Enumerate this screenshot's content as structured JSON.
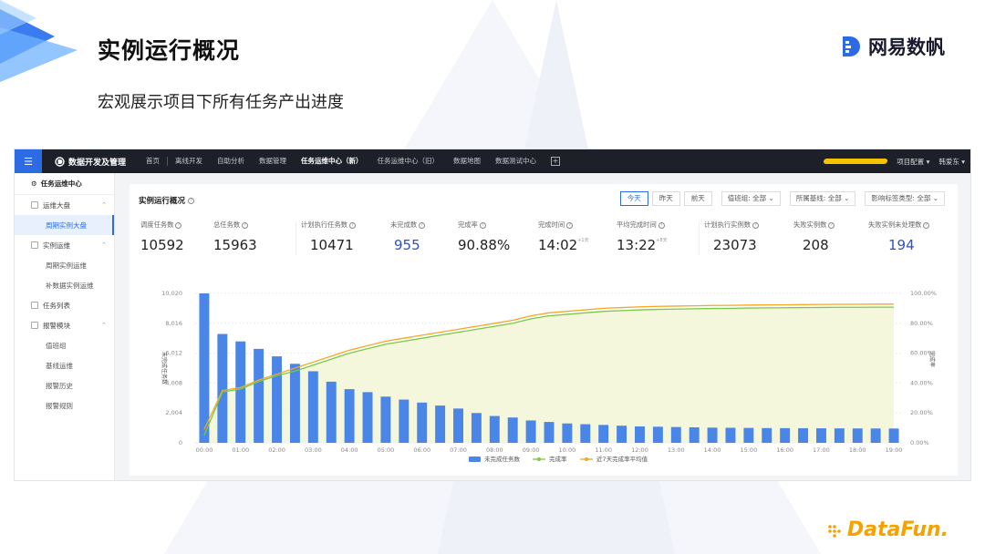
{
  "slide": {
    "title": "实例运行概况",
    "subtitle": "宏观展示项目下所有任务产出进度",
    "brand": "网易数帆",
    "footer_brand": "DataFun."
  },
  "app": {
    "title": "数据开发及管理",
    "nav": [
      {
        "label": "首页",
        "active": false
      },
      {
        "label": "离线开发",
        "active": false
      },
      {
        "label": "自助分析",
        "active": false
      },
      {
        "label": "数据管理",
        "active": false
      },
      {
        "label": "任务运维中心（新）",
        "active": true
      },
      {
        "label": "任务运维中心（旧）",
        "active": false
      },
      {
        "label": "数据地图",
        "active": false
      },
      {
        "label": "数据测试中心",
        "active": false
      }
    ],
    "plus": "+",
    "project_config": "项目配置 ▾",
    "user": "韩爱东 ▾"
  },
  "sidebar": {
    "header": "任务运维中心",
    "groups": [
      {
        "label": "运维大盘",
        "items": [
          {
            "label": "周期实例大盘",
            "active": true
          }
        ]
      },
      {
        "label": "实例运维",
        "items": [
          {
            "label": "周期实例运维",
            "active": false
          },
          {
            "label": "补数据实例运维",
            "active": false
          }
        ]
      },
      {
        "label": "任务列表",
        "items": []
      },
      {
        "label": "报警模块",
        "items": [
          {
            "label": "值班组",
            "active": false
          },
          {
            "label": "基线运维",
            "active": false
          },
          {
            "label": "报警历史",
            "active": false
          },
          {
            "label": "报警规则",
            "active": false
          }
        ]
      }
    ]
  },
  "panel": {
    "title": "实例运行概况",
    "days": [
      {
        "label": "今天",
        "active": true
      },
      {
        "label": "昨天",
        "active": false
      },
      {
        "label": "前天",
        "active": false
      }
    ],
    "selects": [
      "值班组: 全部 ⌄",
      "所属基线: 全部 ⌄",
      "影响标签类型: 全部 ⌄"
    ]
  },
  "stats": [
    {
      "label": "调度任务数",
      "value": "10592",
      "color": "#222222"
    },
    {
      "label": "总任务数",
      "value": "15963",
      "color": "#222222"
    },
    {
      "label": "计划执行任务数",
      "value": "10471",
      "color": "#222222"
    },
    {
      "label": "未完成数",
      "value": "955",
      "color": "#2d4fc7"
    },
    {
      "label": "完成率",
      "value": "90.88%",
      "color": "#222222"
    },
    {
      "label": "完成时间",
      "value": "14:02",
      "sup": "+1天",
      "color": "#222222"
    },
    {
      "label": "平均完成时间",
      "value": "13:22",
      "sup": "+8天",
      "color": "#222222"
    },
    {
      "label": "计划执行实例数",
      "value": "23073",
      "color": "#222222"
    },
    {
      "label": "失败实例数",
      "value": "208",
      "color": "#222222"
    },
    {
      "label": "失败实例未处理数",
      "value": "194",
      "color": "#2d4fc7"
    }
  ],
  "chart_data": {
    "type": "bar",
    "ylabel": "未完成任务数",
    "y2label": "完成率",
    "ylim": [
      0,
      10020
    ],
    "yticks": [
      "0",
      "2,004",
      "4,008",
      "6,012",
      "8,016",
      "10,020"
    ],
    "y2ticks": [
      "0.00%",
      "20.00%",
      "40.00%",
      "60.00%",
      "80.00%",
      "100.00%"
    ],
    "xticks": [
      "00:00",
      "01:00",
      "02:00",
      "03:00",
      "04:00",
      "05:00",
      "06:00",
      "07:00",
      "08:00",
      "09:00",
      "10:00",
      "11:00",
      "12:00",
      "13:00",
      "14:00",
      "15:00",
      "16:00",
      "17:00",
      "18:00",
      "19:00"
    ],
    "legend": [
      "未完成任务数",
      "完成率",
      "近7天完成率平均值"
    ],
    "legend_placement": "bottom",
    "bars": [
      10020,
      7300,
      6800,
      6300,
      5800,
      5300,
      4800,
      4100,
      3600,
      3400,
      3100,
      2900,
      2700,
      2500,
      2300,
      2000,
      1800,
      1700,
      1500,
      1400,
      1300,
      1250,
      1200,
      1150,
      1100,
      1080,
      1060,
      1040,
      1020,
      1010,
      1000,
      990,
      985,
      980,
      975,
      970,
      965,
      962,
      960
    ],
    "completion_rate": [
      0.05,
      0.34,
      0.36,
      0.41,
      0.45,
      0.48,
      0.52,
      0.56,
      0.6,
      0.63,
      0.66,
      0.68,
      0.7,
      0.72,
      0.74,
      0.76,
      0.78,
      0.8,
      0.83,
      0.85,
      0.86,
      0.87,
      0.88,
      0.885,
      0.89,
      0.893,
      0.895,
      0.897,
      0.899,
      0.9,
      0.902,
      0.903,
      0.904,
      0.905,
      0.906,
      0.907,
      0.907,
      0.908,
      0.908
    ],
    "avg7_rate": [
      0.09,
      0.35,
      0.37,
      0.42,
      0.46,
      0.5,
      0.54,
      0.58,
      0.62,
      0.65,
      0.68,
      0.7,
      0.72,
      0.74,
      0.76,
      0.78,
      0.8,
      0.82,
      0.85,
      0.87,
      0.88,
      0.89,
      0.9,
      0.905,
      0.91,
      0.913,
      0.915,
      0.917,
      0.919,
      0.92,
      0.922,
      0.923,
      0.924,
      0.925,
      0.926,
      0.927,
      0.927,
      0.928,
      0.928
    ],
    "colors": {
      "bar": "#4a86e8",
      "completion": "#7ac943",
      "avg7": "#f5a623",
      "area": "#f3f6d8"
    }
  }
}
